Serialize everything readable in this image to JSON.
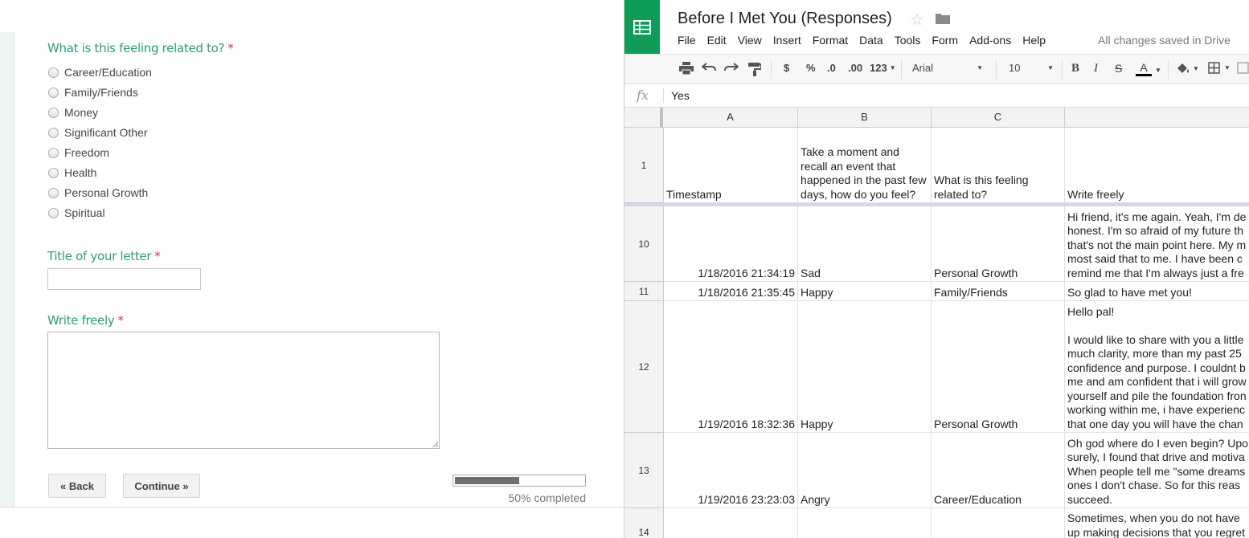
{
  "form": {
    "q_related": {
      "title": "What is this feeling related to?",
      "required_mark": "*",
      "options": [
        "Career/Education",
        "Family/Friends",
        "Money",
        "Significant Other",
        "Freedom",
        "Health",
        "Personal Growth",
        "Spiritual"
      ]
    },
    "q_title": {
      "title": "Title of your letter",
      "required_mark": "*",
      "value": ""
    },
    "q_write": {
      "title": "Write freely",
      "required_mark": "*",
      "value": ""
    },
    "back_label": "« Back",
    "continue_label": "Continue »",
    "progress": {
      "percent": 50,
      "label": "50% completed"
    }
  },
  "sheet": {
    "title": "Before I Met You (Responses)",
    "menu": [
      "File",
      "Edit",
      "View",
      "Insert",
      "Format",
      "Data",
      "Tools",
      "Form",
      "Add-ons",
      "Help"
    ],
    "save_status": "All changes saved in Drive",
    "toolbar": {
      "currency": "$",
      "percent": "%",
      "dec_less": ".0",
      "dec_more": ".00",
      "more_formats": "123",
      "font": "Arial",
      "font_size": "10",
      "bold": "B",
      "italic": "I",
      "strike": "S",
      "text_color": "A"
    },
    "formula_icon": "fx",
    "formula_value": "Yes",
    "columns": [
      "A",
      "B",
      "C",
      ""
    ],
    "header_row": {
      "num": "1",
      "cells": [
        "Timestamp",
        "Take a moment and recall an event that happened in the past few days, how do you feel?",
        "What is this feeling related to?",
        "Write freely"
      ]
    },
    "rows": [
      {
        "num": "10",
        "timestamp": "1/18/2016 21:34:19",
        "feeling": "Sad",
        "related": "Personal Growth",
        "text": "Hi friend, it's me again. Yeah, I'm de\nhonest. I'm so afraid of my future th\nthat's not the main point here. My m\nmost said that to me. I have been c\nremind me that I'm always just a fre"
      },
      {
        "num": "11",
        "timestamp": "1/18/2016 21:35:45",
        "feeling": "Happy",
        "related": "Family/Friends",
        "text": "So glad to have met you!"
      },
      {
        "num": "12",
        "timestamp": "1/19/2016 18:32:36",
        "feeling": "Happy",
        "related": "Personal Growth",
        "text": "Hello pal!\n\nI would like to share with you a little\nmuch clarity, more than my past 25\nconfidence and purpose. I couldnt b\nme and am confident that i will grow\nyourself and pile the foundation fron\nworking within me, i have experienc\nthat one day you will have the chan"
      },
      {
        "num": "13",
        "timestamp": "1/19/2016 23:23:03",
        "feeling": "Angry",
        "related": "Career/Education",
        "text": "Oh god where do I even begin? Upo\nsurely, I found that drive and motiva\nWhen people tell me \"some dreams\nones I don't chase. So for this reas\nsucceed."
      },
      {
        "num": "14",
        "timestamp": "",
        "feeling": "",
        "related": "",
        "text": "Sometimes, when you do not have\nup making decisions that you regret"
      }
    ]
  }
}
